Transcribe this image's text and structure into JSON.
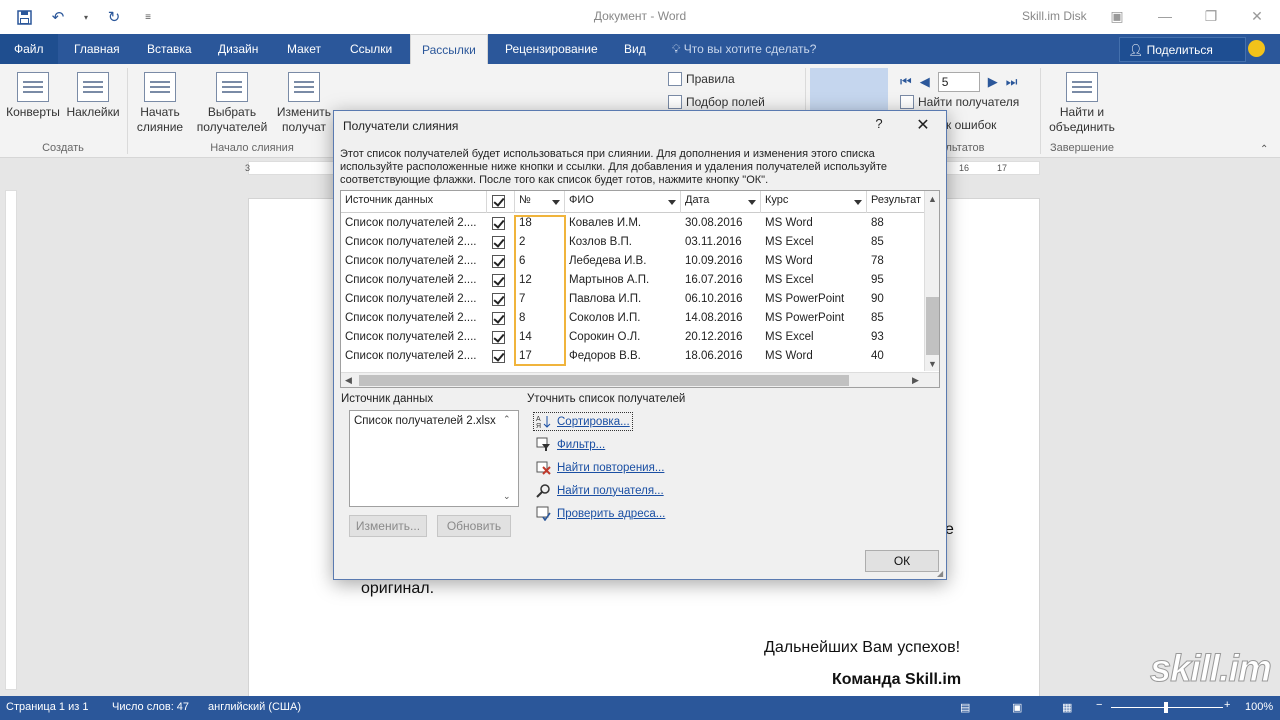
{
  "titlebar": {
    "doc_title": "Документ  -  Word",
    "account": "Skill.im Disk"
  },
  "tabs": {
    "file": "Файл",
    "items": [
      "Главная",
      "Вставка",
      "Дизайн",
      "Макет",
      "Ссылки",
      "Рассылки",
      "Рецензирование",
      "Вид"
    ],
    "active": "Рассылки",
    "tellme": "Что вы хотите сделать?",
    "share": "Поделиться"
  },
  "ribbon": {
    "envelopes": "Конверты",
    "labels": "Наклейки",
    "start_merge_1": "Начать",
    "start_merge_2": "слияние",
    "select_recipients_1": "Выбрать",
    "select_recipients_2": "получателей",
    "edit_list_1": "Изменить",
    "edit_list_2": "получат",
    "rules": "Правила",
    "match_fields": "Подбор полей",
    "record_number": "5",
    "find_recipient": "Найти получателя",
    "check_errors": "ск ошибок",
    "finish_1": "Найти и",
    "finish_2": "объединить",
    "group_create": "Создать",
    "group_start": "Начало слияния",
    "group_results": "льтатов",
    "group_finish": "Завершение"
  },
  "document": {
    "line_fragment": "е",
    "line_original": "оригинал.",
    "line_wishes": "Дальнейших Вам успехов!",
    "line_team": "Команда Skill.im",
    "watermark": "skill.im"
  },
  "statusbar": {
    "page": "Страница 1 из 1",
    "words": "Число слов: 47",
    "language": "английский (США)",
    "zoom": "100%"
  },
  "dialog": {
    "title": "Получатели слияния",
    "help": "?",
    "description": "Этот список получателей будет использоваться при слиянии. Для дополнения и изменения этого списка используйте расположенные ниже кнопки и ссылки. Для добавления и удаления получателей используйте соответствующие флажки. После того как список будет готов, нажмите кнопку \"ОК\".",
    "columns": {
      "source": "Источник данных",
      "num": "№",
      "name": "ФИО",
      "date": "Дата",
      "course": "Курс",
      "result": "Результат"
    },
    "rows": [
      {
        "source": "Список получателей 2....",
        "num": "18",
        "name": "Ковалев И.М.",
        "date": "30.08.2016",
        "course": "MS Word",
        "result": "88"
      },
      {
        "source": "Список получателей 2....",
        "num": "2",
        "name": "Козлов В.П.",
        "date": "03.11.2016",
        "course": "MS Excel",
        "result": "85"
      },
      {
        "source": "Список получателей 2....",
        "num": "6",
        "name": "Лебедева И.В.",
        "date": "10.09.2016",
        "course": "MS Word",
        "result": "78"
      },
      {
        "source": "Список получателей 2....",
        "num": "12",
        "name": "Мартынов А.П.",
        "date": "16.07.2016",
        "course": "MS Excel",
        "result": "95"
      },
      {
        "source": "Список получателей 2....",
        "num": "7",
        "name": "Павлова И.П.",
        "date": "06.10.2016",
        "course": "MS PowerPoint",
        "result": "90"
      },
      {
        "source": "Список получателей 2....",
        "num": "8",
        "name": "Соколов И.П.",
        "date": "14.08.2016",
        "course": "MS PowerPoint",
        "result": "85"
      },
      {
        "source": "Список получателей 2....",
        "num": "14",
        "name": "Сорокин О.Л.",
        "date": "20.12.2016",
        "course": "MS Excel",
        "result": "93"
      },
      {
        "source": "Список получателей 2....",
        "num": "17",
        "name": "Федоров В.В.",
        "date": "18.06.2016",
        "course": "MS Word",
        "result": "40"
      }
    ],
    "source_label": "Источник данных",
    "source_item": "Список получателей 2.xlsx",
    "edit_button": "Изменить...",
    "refresh_button": "Обновить",
    "refine_label": "Уточнить список получателей",
    "links": {
      "sort": "Сортировка...",
      "filter": "Фильтр...",
      "duplicates": "Найти повторения...",
      "find": "Найти получателя...",
      "validate": "Проверить адреса..."
    },
    "ok": "ОК"
  },
  "colors": {
    "word_blue": "#2b579a",
    "highlight": "#f0b43c",
    "link": "#1a4fa3"
  }
}
